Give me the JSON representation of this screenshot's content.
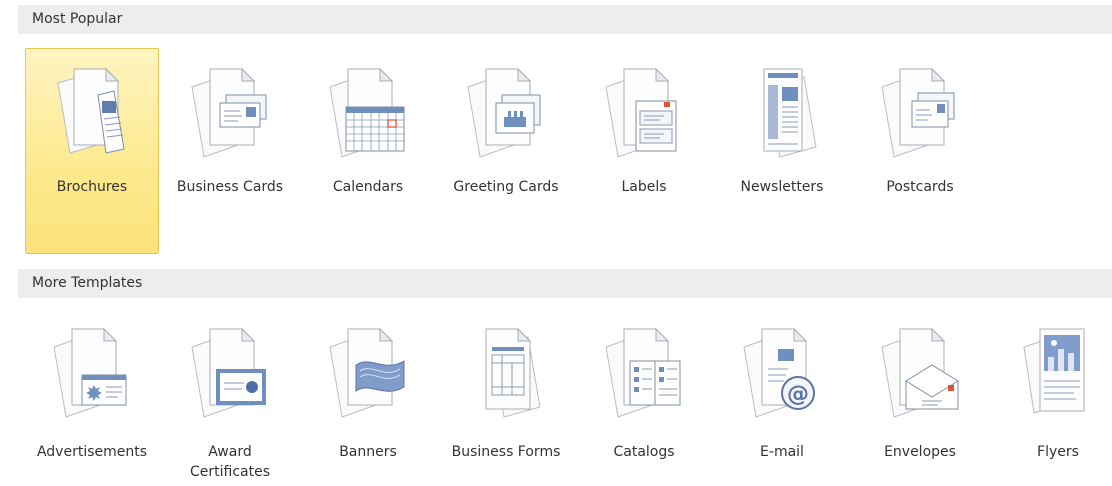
{
  "sections": [
    {
      "title": "Most Popular",
      "items": [
        {
          "label": "Brochures",
          "icon": "brochure-icon",
          "selected": true
        },
        {
          "label": "Business Cards",
          "icon": "business-card-icon"
        },
        {
          "label": "Calendars",
          "icon": "calendar-icon"
        },
        {
          "label": "Greeting Cards",
          "icon": "greeting-card-icon"
        },
        {
          "label": "Labels",
          "icon": "label-icon"
        },
        {
          "label": "Newsletters",
          "icon": "newsletter-icon"
        },
        {
          "label": "Postcards",
          "icon": "postcard-icon"
        }
      ]
    },
    {
      "title": "More Templates",
      "items": [
        {
          "label": "Advertisements",
          "icon": "advertisement-icon"
        },
        {
          "label": "Award\nCertificates",
          "icon": "award-certificate-icon"
        },
        {
          "label": "Banners",
          "icon": "banner-icon"
        },
        {
          "label": "Business Forms",
          "icon": "business-form-icon"
        },
        {
          "label": "Catalogs",
          "icon": "catalog-icon"
        },
        {
          "label": "E-mail",
          "icon": "email-icon"
        },
        {
          "label": "Envelopes",
          "icon": "envelope-icon"
        },
        {
          "label": "Flyers",
          "icon": "flyer-icon"
        }
      ]
    }
  ],
  "colors": {
    "selected_tile": "#fde98d",
    "header_bg": "#ecedee",
    "icon_blue": "#6f8fbf",
    "icon_accent": "#e0513a"
  }
}
